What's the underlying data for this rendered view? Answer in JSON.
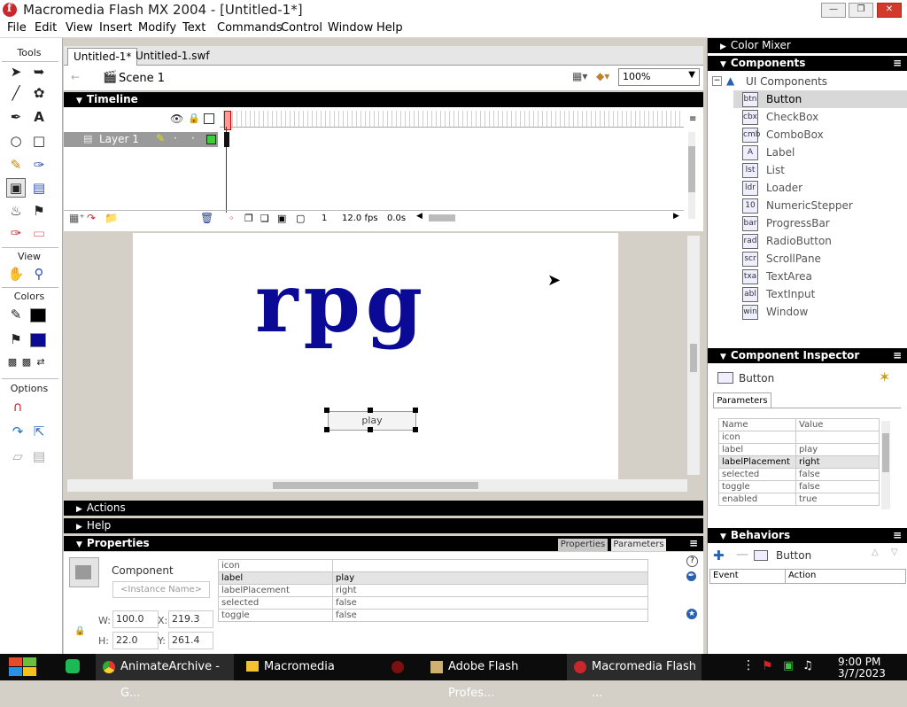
{
  "window": {
    "title": "Macromedia Flash MX 2004 - [Untitled-1*]"
  },
  "menu": [
    "File",
    "Edit",
    "View",
    "Insert",
    "Modify",
    "Text",
    "Commands",
    "Control",
    "Window",
    "Help"
  ],
  "tools": {
    "title": "Tools",
    "view_label": "View",
    "colors_label": "Colors",
    "options_label": "Options"
  },
  "doc": {
    "tabs": [
      "Untitled-1*",
      "Untitled-1.swf"
    ],
    "scene": "Scene 1",
    "zoom": "100%"
  },
  "timeline": {
    "title": "Timeline",
    "layer": "Layer 1",
    "frame": "1",
    "fps": "12.0 fps",
    "time": "0.0s"
  },
  "stage": {
    "text": "rpg",
    "button_label": "play",
    "text_color": "#0a0a96"
  },
  "panels": {
    "actions": "Actions",
    "help": "Help",
    "properties": "Properties",
    "tab_properties": "Properties",
    "tab_parameters": "Parameters"
  },
  "properties": {
    "type": "Component",
    "instance_name_placeholder": "<Instance Name>",
    "w_label": "W:",
    "w": "100.0",
    "h_label": "H:",
    "h": "22.0",
    "x_label": "X:",
    "x": "219.3",
    "y_label": "Y:",
    "y": "261.4",
    "params": [
      {
        "name": "icon",
        "value": ""
      },
      {
        "name": "label",
        "value": "play"
      },
      {
        "name": "labelPlacement",
        "value": "right"
      },
      {
        "name": "selected",
        "value": "false"
      },
      {
        "name": "toggle",
        "value": "false"
      }
    ]
  },
  "right": {
    "color_mixer": "Color Mixer",
    "components": "Components",
    "ui_components": "UI Components",
    "component_list": [
      "Button",
      "CheckBox",
      "ComboBox",
      "Label",
      "List",
      "Loader",
      "NumericStepper",
      "ProgressBar",
      "RadioButton",
      "ScrollPane",
      "TextArea",
      "TextInput",
      "Window"
    ],
    "component_icons": [
      "btn",
      "cbx",
      "cmb",
      "A",
      "lst",
      "ldr",
      "10",
      "bar",
      "rad",
      "scr",
      "txa",
      "abl",
      "win"
    ],
    "inspector_title": "Component Inspector",
    "inspector_component": "Button",
    "parameters_tab": "Parameters",
    "param_header": [
      "Name",
      "Value"
    ],
    "params": [
      {
        "name": "icon",
        "value": ""
      },
      {
        "name": "label",
        "value": "play"
      },
      {
        "name": "labelPlacement",
        "value": "right"
      },
      {
        "name": "selected",
        "value": "false"
      },
      {
        "name": "toggle",
        "value": "false"
      },
      {
        "name": "enabled",
        "value": "true"
      }
    ],
    "behaviors_title": "Behaviors",
    "behaviors_component": "Button",
    "behaviors_header": [
      "Event",
      "Action"
    ]
  },
  "taskbar": {
    "apps": [
      {
        "label": "AnimateArchive - G...",
        "icon": "chrome-icon"
      },
      {
        "label": "Macromedia",
        "icon": "folder-icon"
      },
      {
        "label": "",
        "icon": "flash-icon"
      },
      {
        "label": "Adobe Flash Profes...",
        "icon": "package-icon"
      },
      {
        "label": "Macromedia Flash ...",
        "icon": "flash-icon"
      }
    ],
    "time": "9:00 PM",
    "date": "3/7/2023"
  }
}
